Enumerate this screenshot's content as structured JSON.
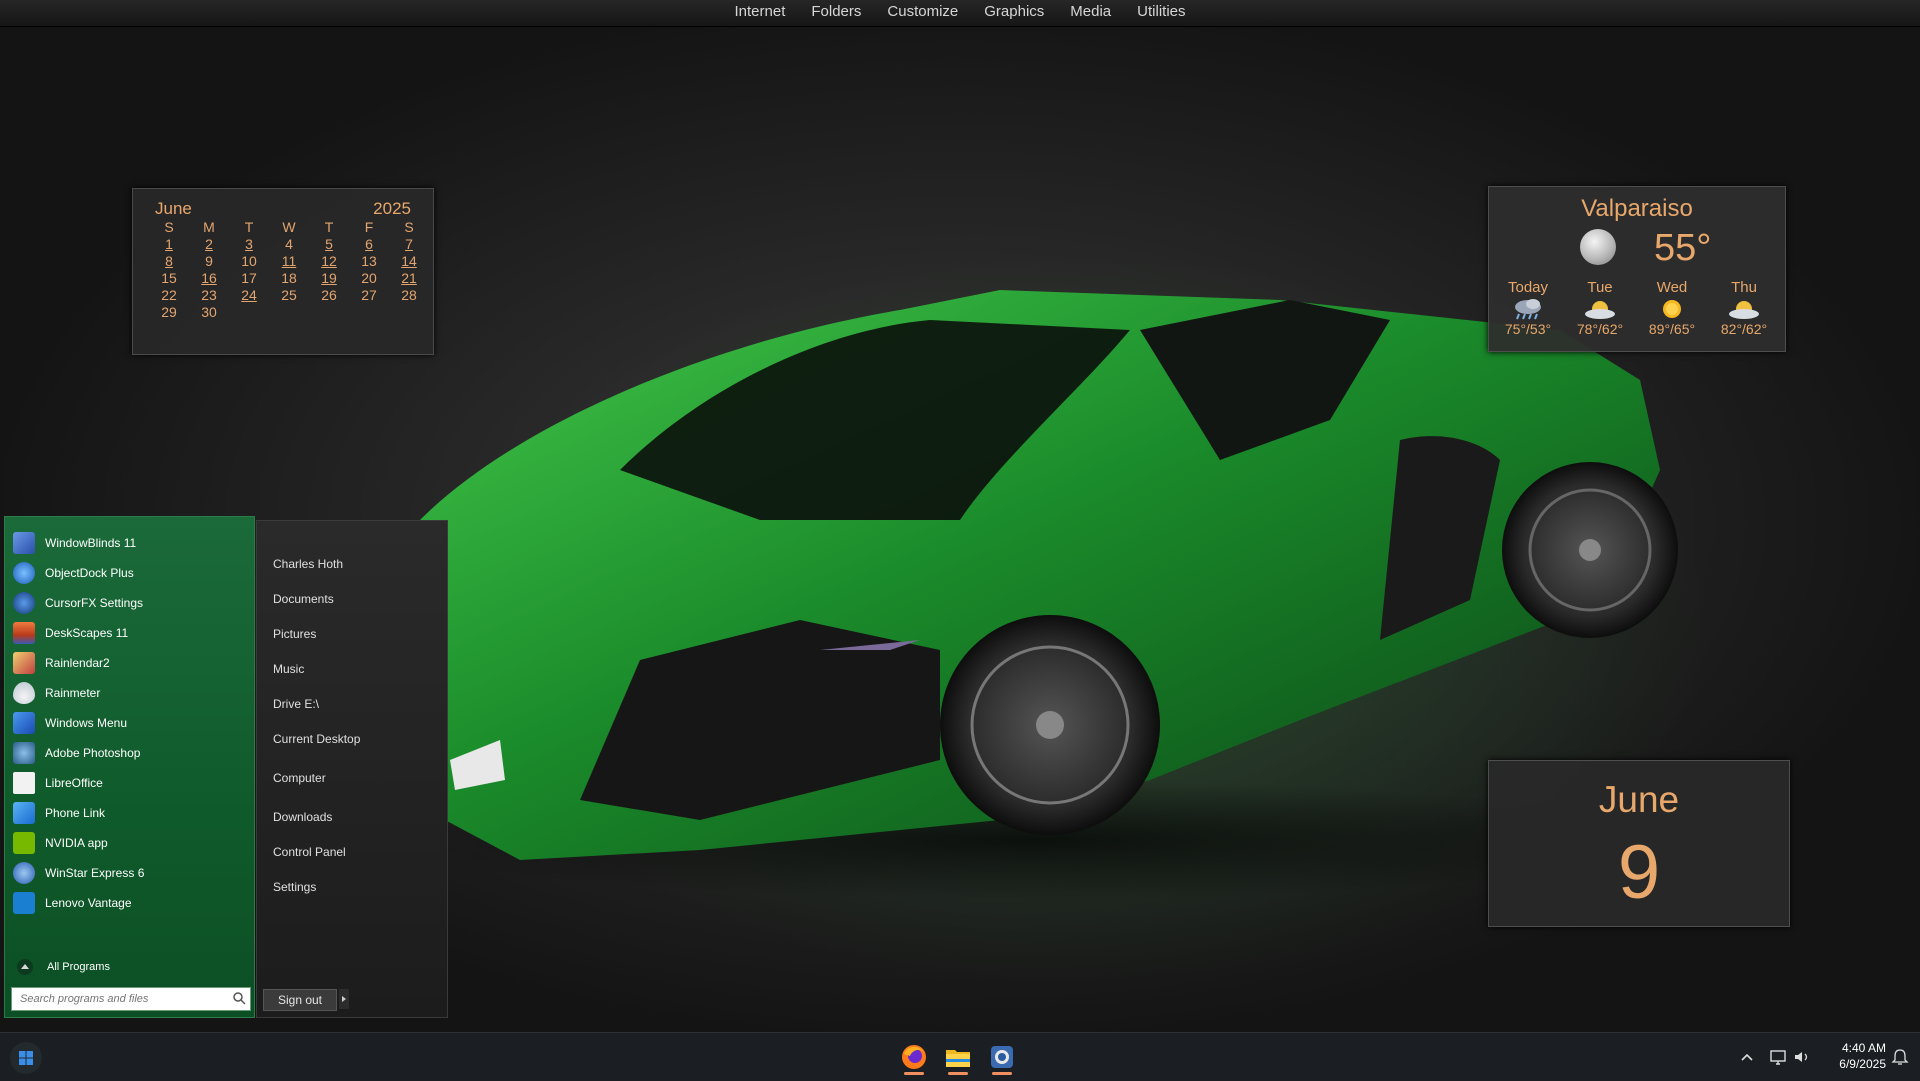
{
  "topbar": {
    "items": [
      "Internet",
      "Folders",
      "Customize",
      "Graphics",
      "Media",
      "Utilities"
    ]
  },
  "calendar": {
    "month": "June",
    "year": "2025",
    "weekdays": [
      "S",
      "M",
      "T",
      "W",
      "T",
      "F",
      "S"
    ],
    "weeks": [
      [
        "1",
        "2",
        "3",
        "4",
        "5",
        "6",
        "7"
      ],
      [
        "8",
        "9",
        "10",
        "11",
        "12",
        "13",
        "14"
      ],
      [
        "15",
        "16",
        "17",
        "18",
        "19",
        "20",
        "21"
      ],
      [
        "22",
        "23",
        "24",
        "25",
        "26",
        "27",
        "28"
      ],
      [
        "29",
        "30",
        "",
        "",
        "",
        "",
        ""
      ]
    ]
  },
  "weather": {
    "city": "Valparaiso",
    "current_temp": "55°",
    "current_icon": "moon-icon",
    "forecast": [
      {
        "day": "Today",
        "icon": "rain-cloud-icon",
        "temps": "75°/53°"
      },
      {
        "day": "Tue",
        "icon": "partly-cloudy-icon",
        "temps": "78°/62°"
      },
      {
        "day": "Wed",
        "icon": "sun-icon",
        "temps": "89°/65°"
      },
      {
        "day": "Thu",
        "icon": "partly-cloudy-icon",
        "temps": "82°/62°"
      }
    ]
  },
  "date_widget": {
    "month": "June",
    "day": "9"
  },
  "start_menu": {
    "programs": [
      {
        "label": "WindowBlinds 11",
        "icon": "windowblinds-icon",
        "color": "#3a6fd0"
      },
      {
        "label": "ObjectDock Plus",
        "icon": "objectdock-icon",
        "color": "#2a7ad8"
      },
      {
        "label": "CursorFX Settings",
        "icon": "cursorfx-icon",
        "color": "#1f5fb8"
      },
      {
        "label": "DeskScapes 11",
        "icon": "deskscapes-icon",
        "color": "#e06a3a"
      },
      {
        "label": "Rainlendar2",
        "icon": "rainlendar-icon",
        "color": "#d4a030"
      },
      {
        "label": "Rainmeter",
        "icon": "rainmeter-icon",
        "color": "#e8e8e8"
      },
      {
        "label": "Windows Menu",
        "icon": "windows-menu-icon",
        "color": "#2a6ad8"
      },
      {
        "label": "Adobe Photoshop",
        "icon": "photoshop-icon",
        "color": "#4a8ac0"
      },
      {
        "label": "LibreOffice",
        "icon": "libreoffice-icon",
        "color": "#f0f0f0"
      },
      {
        "label": "Phone Link",
        "icon": "phone-link-icon",
        "color": "#2a8ae0"
      },
      {
        "label": "NVIDIA app",
        "icon": "nvidia-icon",
        "color": "#76b900"
      },
      {
        "label": "WinStar Express 6",
        "icon": "winstar-icon",
        "color": "#3a7ad0"
      },
      {
        "label": "Lenovo Vantage",
        "icon": "lenovo-vantage-icon",
        "color": "#1a7fd0"
      }
    ],
    "all_programs": "All Programs",
    "search_placeholder": "Search programs and files",
    "places": [
      "Charles Hoth",
      "Documents",
      "Pictures",
      "Music",
      "Drive E:\\",
      "Current Desktop",
      "Computer",
      "Downloads",
      "Control Panel",
      "Settings"
    ],
    "sign_out": "Sign out"
  },
  "taskbar": {
    "apps": [
      {
        "name": "firefox-icon"
      },
      {
        "name": "file-explorer-icon"
      },
      {
        "name": "photo-app-icon"
      }
    ],
    "time": "4:40 AM",
    "date": "6/9/2025"
  }
}
